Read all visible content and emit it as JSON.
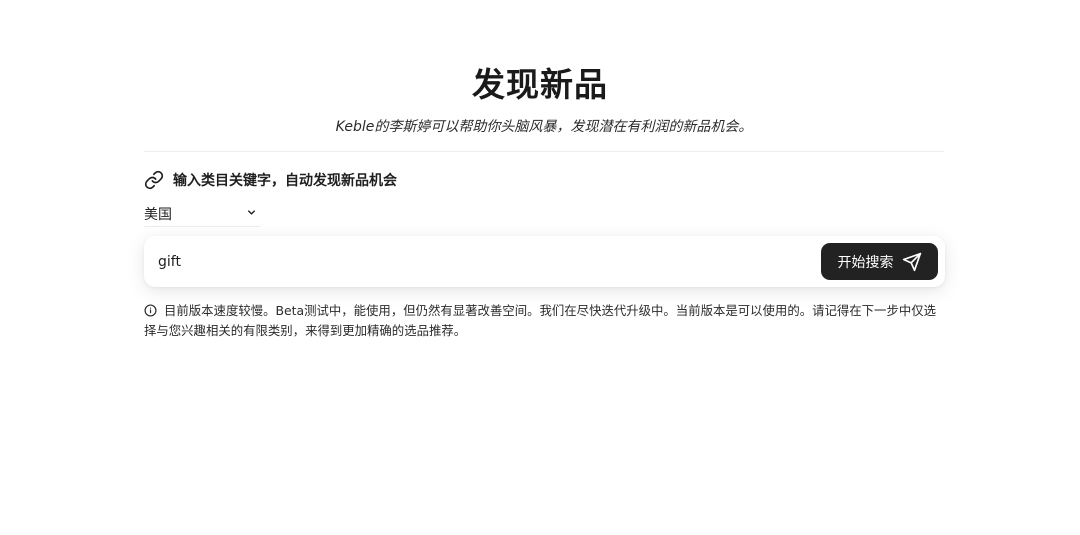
{
  "header": {
    "title": "发现新品",
    "subtitle": "Keble的李斯婷可以帮助你头脑风暴，发现潜在有利润的新品机会。"
  },
  "section": {
    "label": "输入类目关键字，自动发现新品机会",
    "icon": "link-icon"
  },
  "country_select": {
    "selected": "美国",
    "icon": "chevron-down-icon"
  },
  "search": {
    "value": "gift",
    "button_label": "开始搜索",
    "button_icon": "send-icon"
  },
  "notice": {
    "icon": "info-icon",
    "text": "目前版本速度较慢。Beta测试中，能使用，但仍然有显著改善空间。我们在尽快迭代升级中。当前版本是可以使用的。请记得在下一步中仅选择与您兴趣相关的有限类别，来得到更加精确的选品推荐。"
  },
  "colors": {
    "button_bg": "#222222",
    "text": "#1f1f1f",
    "background": "#ffffff"
  }
}
